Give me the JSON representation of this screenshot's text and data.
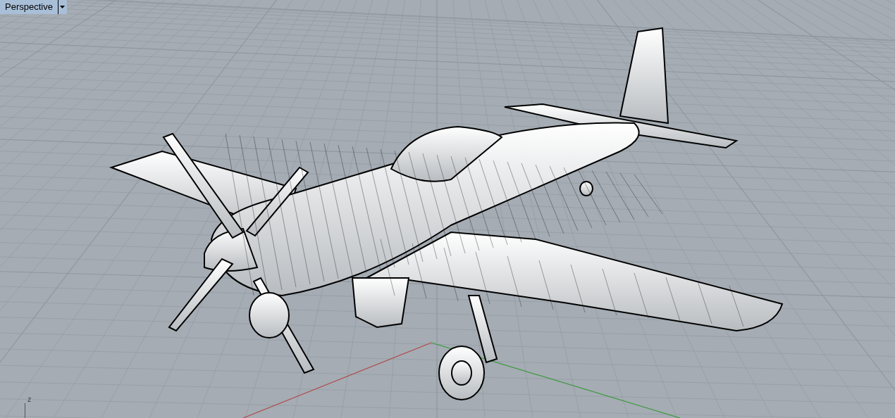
{
  "viewport": {
    "title": "Perspective",
    "axis_label": "z"
  }
}
